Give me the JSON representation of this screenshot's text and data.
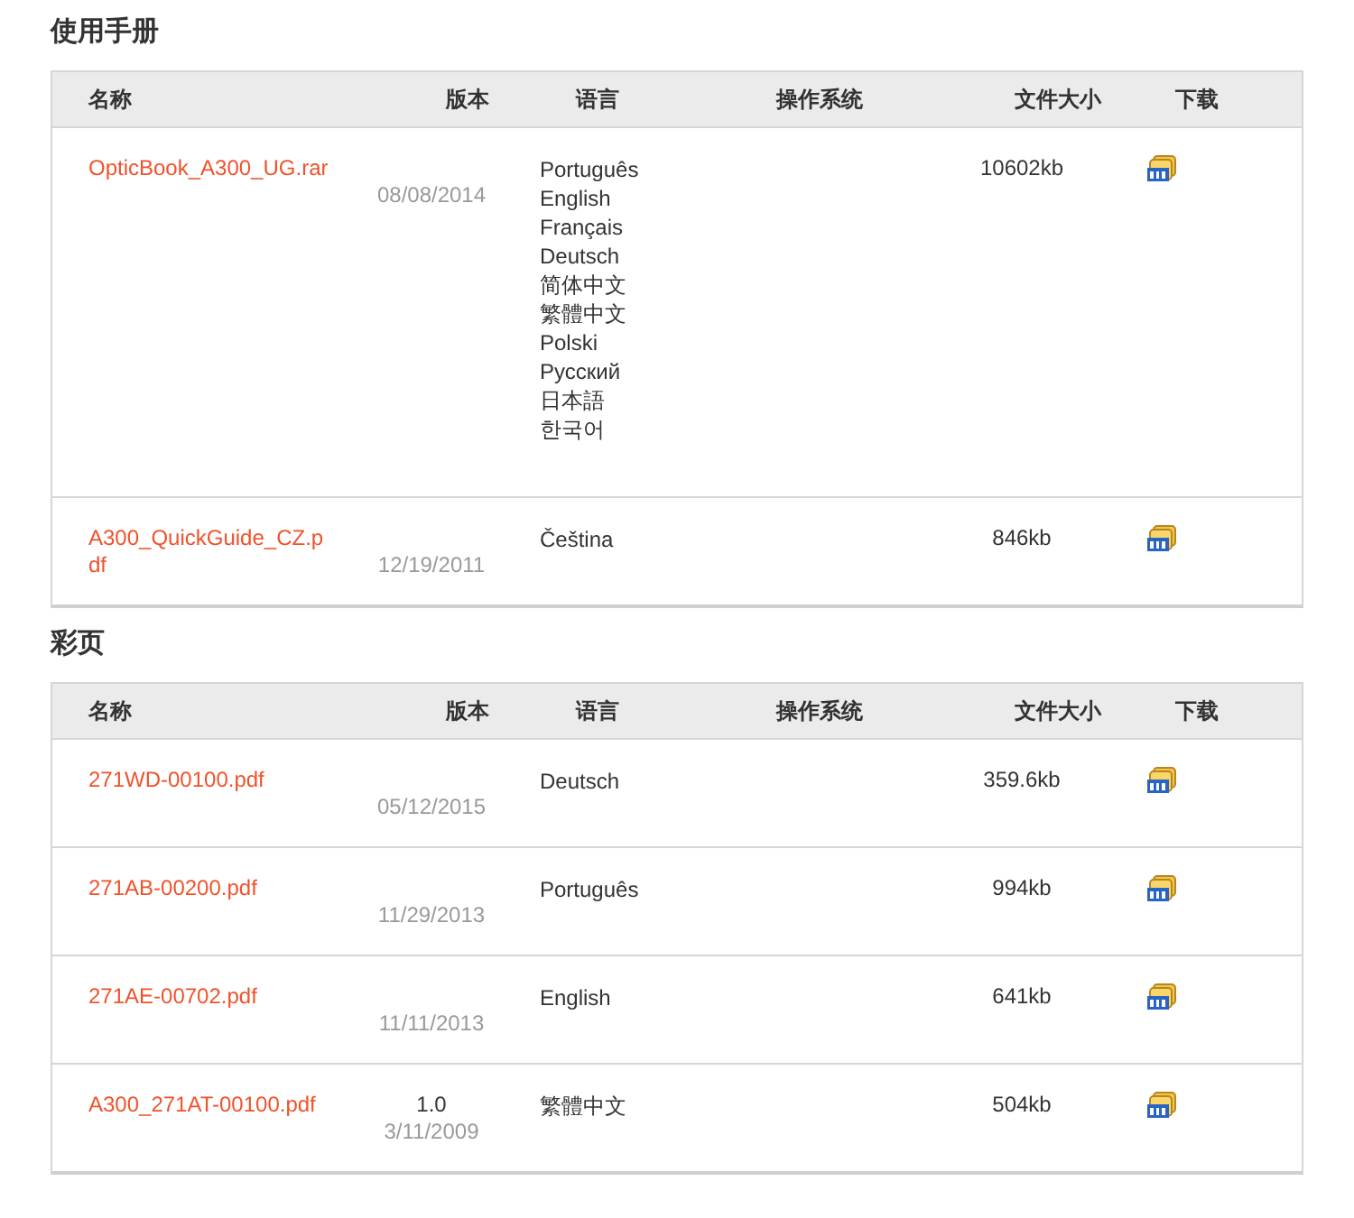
{
  "sections": [
    {
      "title": "使用手册",
      "columns": [
        "名称",
        "版本",
        "语言",
        "操作系统",
        "文件大小",
        "下载"
      ],
      "rows": [
        {
          "name": "OpticBook_A300_UG.rar",
          "date": "08/08/2014",
          "languages": [
            "Português",
            "English",
            "Français",
            "Deutsch",
            "简体中文",
            "繁體中文",
            "Polski",
            "Русский",
            "日本語",
            "한국어"
          ],
          "size": "10602kb"
        },
        {
          "name": "A300_QuickGuide_CZ.pdf",
          "date": "12/19/2011",
          "languages": [
            "Čeština"
          ],
          "size": "846kb"
        }
      ]
    },
    {
      "title": "彩页",
      "columns": [
        "名称",
        "版本",
        "语言",
        "操作系统",
        "文件大小",
        "下载"
      ],
      "rows": [
        {
          "name": "271WD-00100.pdf",
          "date": "05/12/2015",
          "languages": [
            "Deutsch"
          ],
          "size": "359.6kb"
        },
        {
          "name": "271AB-00200.pdf",
          "date": "11/29/2013",
          "languages": [
            "Português"
          ],
          "size": "994kb"
        },
        {
          "name": "271AE-00702.pdf",
          "date": "11/11/2013",
          "languages": [
            "English"
          ],
          "size": "641kb"
        },
        {
          "name": "A300_271AT-00100.pdf",
          "version": "1.0",
          "date": "3/11/2009",
          "languages": [
            "繁體中文"
          ],
          "size": "504kb"
        }
      ]
    }
  ]
}
